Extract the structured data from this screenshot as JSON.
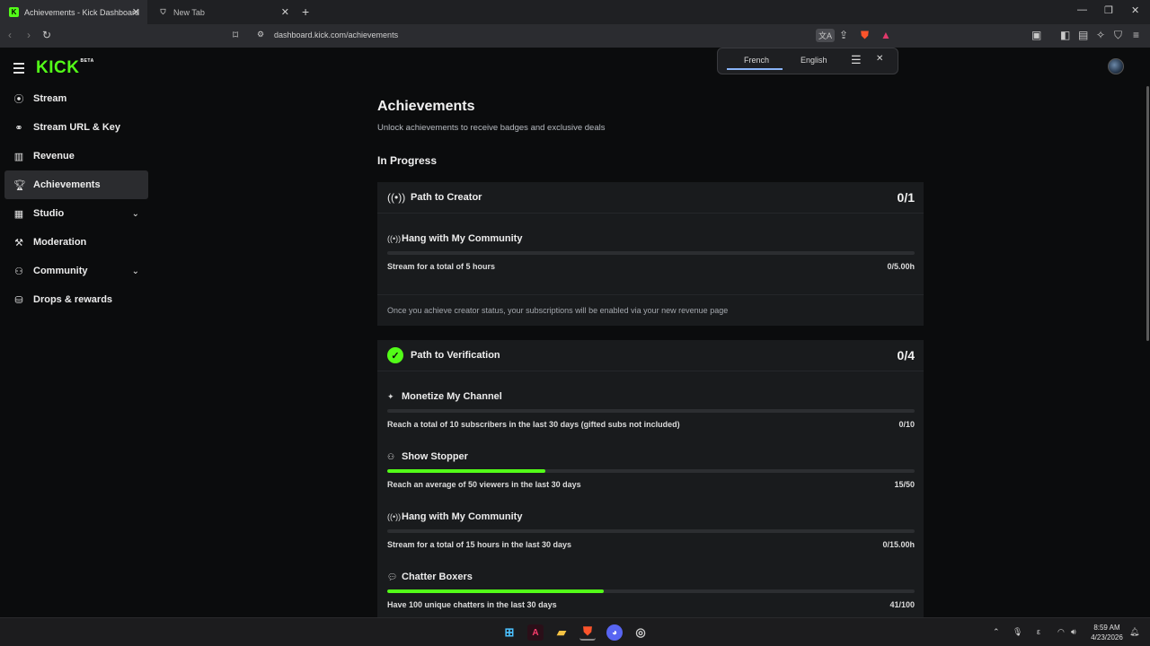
{
  "browser": {
    "tabs": [
      {
        "title": "Achievements - Kick Dashboard",
        "active": true
      },
      {
        "title": "New Tab",
        "active": false
      }
    ],
    "url": "dashboard.kick.com/achievements",
    "translate": {
      "from": "French",
      "to": "English"
    }
  },
  "sidebar": {
    "logo": "KICK",
    "logo_tag": "BETA",
    "items": [
      {
        "label": "Stream",
        "icon": "broadcast-icon"
      },
      {
        "label": "Stream URL & Key",
        "icon": "link-icon"
      },
      {
        "label": "Revenue",
        "icon": "chart-icon"
      },
      {
        "label": "Achievements",
        "icon": "trophy-icon",
        "active": true
      },
      {
        "label": "Studio",
        "icon": "studio-icon",
        "expandable": true
      },
      {
        "label": "Moderation",
        "icon": "wrench-icon"
      },
      {
        "label": "Community",
        "icon": "community-icon",
        "expandable": true
      },
      {
        "label": "Drops & rewards",
        "icon": "drops-icon"
      }
    ]
  },
  "main": {
    "title": "Achievements",
    "subtitle": "Unlock achievements to receive badges and exclusive deals",
    "section": "In Progress",
    "cards": [
      {
        "title": "Path to Creator",
        "score": "0/1",
        "achievements": [
          {
            "title": "Hang with My Community",
            "description": "Stream for a total of 5 hours",
            "progress": "0/5.00h",
            "fraction": 0
          }
        ],
        "note": "Once you achieve creator status, your subscriptions will be enabled via your new revenue page"
      },
      {
        "title": "Path to Verification",
        "score": "0/4",
        "achievements": [
          {
            "title": "Monetize My Channel",
            "description": "Reach a total of 10 subscribers in the last 30 days (gifted subs not included)",
            "progress": "0/10",
            "fraction": 0
          },
          {
            "title": "Show Stopper",
            "description": "Reach an average of 50 viewers in the last 30 days",
            "progress": "15/50",
            "fraction": 0.3
          },
          {
            "title": "Hang with My Community",
            "description": "Stream for a total of 15 hours in the last 30 days",
            "progress": "0/15.00h",
            "fraction": 0
          },
          {
            "title": "Chatter Boxers",
            "description": "Have 100 unique chatters in the last 30 days",
            "progress": "41/100",
            "fraction": 0.41
          }
        ]
      }
    ]
  },
  "taskbar": {
    "time": "8:59 AM",
    "date": "4/23/2026",
    "lang": "ε"
  },
  "colors": {
    "accent": "#53fc18",
    "background": "#0b0c0d",
    "card": "#191b1d"
  }
}
